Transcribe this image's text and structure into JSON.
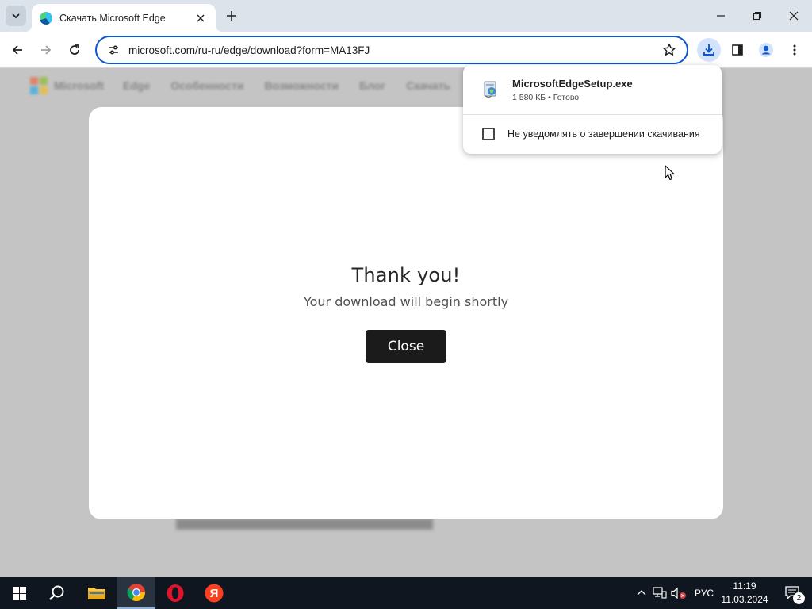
{
  "browser": {
    "tab_title": "Скачать Microsoft Edge",
    "url": "microsoft.com/ru-ru/edge/download?form=MA13FJ"
  },
  "modal": {
    "heading": "Thank you!",
    "message": "Your download will begin shortly",
    "close_label": "Close"
  },
  "download_bubble": {
    "file_name": "MicrosoftEdgeSetup.exe",
    "file_status": "1 580 КБ • Готово",
    "option_label": "Не уведомлять о завершении скачивания"
  },
  "site_nav": {
    "brand": "Microsoft",
    "items": [
      "Edge",
      "Особенности",
      "Возможности",
      "Блог",
      "Скачать"
    ]
  },
  "taskbar": {
    "language": "РУС",
    "time": "11:19",
    "date": "11.03.2024",
    "notifications": "2",
    "yandex_letter": "Я"
  },
  "colors": {
    "accent": "#0b57d0",
    "tabstrip": "#dde3ea",
    "taskbar": "#10161f",
    "close_button": "#1b1b1b"
  }
}
